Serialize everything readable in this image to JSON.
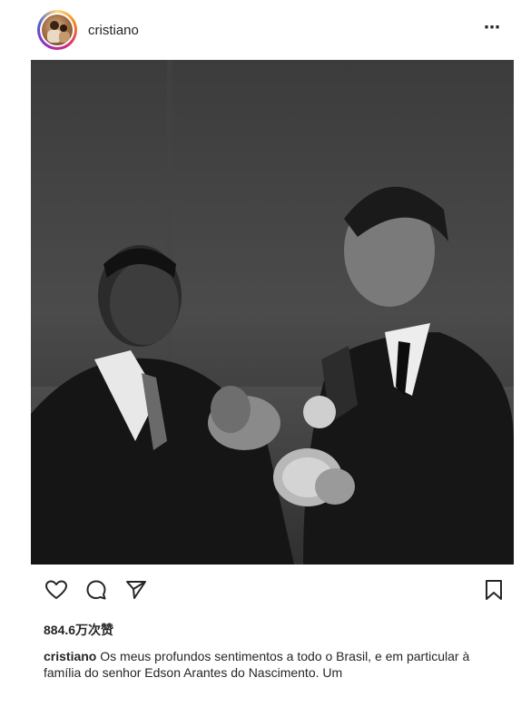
{
  "header": {
    "username": "cristiano",
    "more_label": "⋯",
    "avatar_icon": "avatar-photo"
  },
  "photo": {
    "description_icon": "post-photo",
    "tone": "black-and-white"
  },
  "actions": {
    "like_icon": "heart-icon",
    "comment_icon": "comment-icon",
    "share_icon": "send-icon",
    "save_icon": "bookmark-icon"
  },
  "likes": {
    "label": "884.6万次赞"
  },
  "caption": {
    "username": "cristiano",
    "text": "Os meus profundos sentimentos a todo o Brasil, e em particular à família do senhor Edson Arantes do Nascimento. Um"
  },
  "colors": {
    "text": "#262626",
    "background": "#ffffff",
    "ring": "#d62976"
  }
}
